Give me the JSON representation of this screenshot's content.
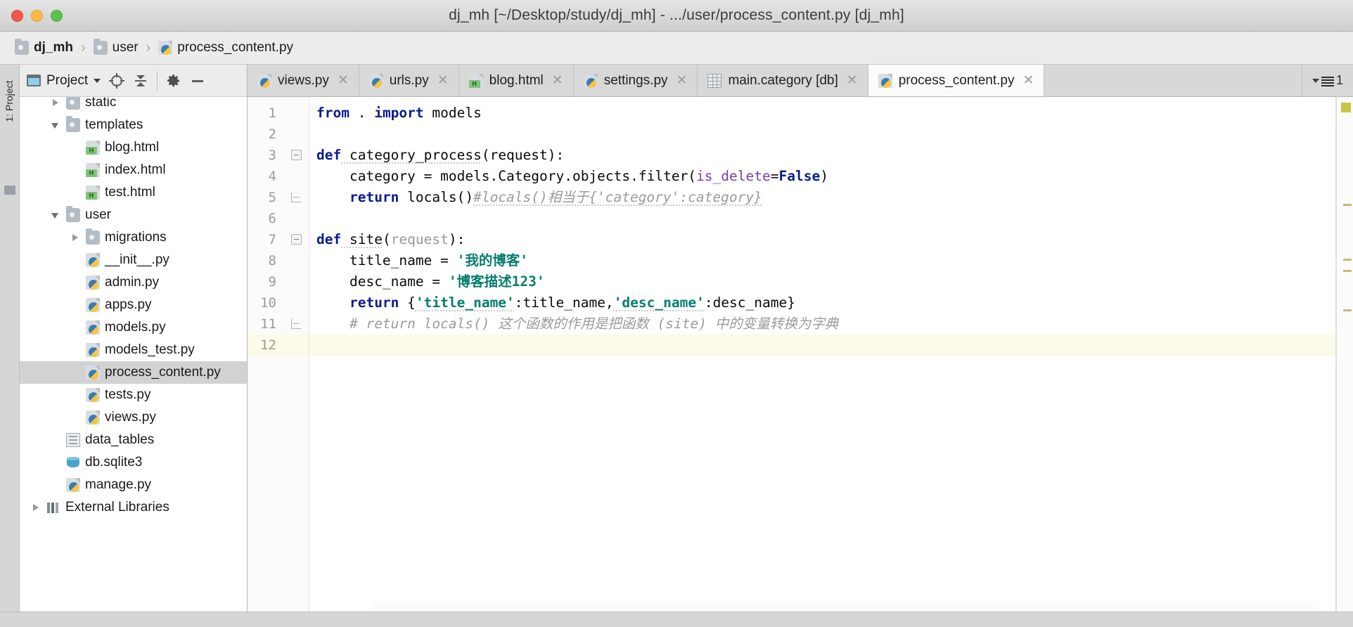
{
  "window": {
    "title": "dj_mh [~/Desktop/study/dj_mh] - .../user/process_content.py [dj_mh]",
    "traffic_lights": [
      "close",
      "minimize",
      "zoom"
    ]
  },
  "breadcrumb": {
    "items": [
      {
        "label": "dj_mh",
        "icon": "folder-icon",
        "bold": true
      },
      {
        "label": "user",
        "icon": "folder-icon",
        "bold": false
      },
      {
        "label": "process_content.py",
        "icon": "python-file-icon",
        "bold": false
      }
    ],
    "separator": "›"
  },
  "rail": {
    "project_tab_label": "1: Project"
  },
  "project_panel": {
    "title": "Project",
    "toolbar_buttons": [
      {
        "name": "select-opened-file",
        "glyph": "⊕"
      },
      {
        "name": "collapse-all",
        "glyph": "⤓"
      },
      {
        "name": "settings",
        "glyph": "⚙"
      },
      {
        "name": "hide",
        "glyph": "—"
      }
    ],
    "tree": [
      {
        "label": "static",
        "icon": "folder-icon",
        "arrow": "right",
        "indent": 2,
        "selected": false,
        "clipped": true
      },
      {
        "label": "templates",
        "icon": "folder-icon",
        "arrow": "down",
        "indent": 2,
        "selected": false
      },
      {
        "label": "blog.html",
        "icon": "html-file-icon",
        "arrow": "none",
        "indent": 3,
        "selected": false
      },
      {
        "label": "index.html",
        "icon": "html-file-icon",
        "arrow": "none",
        "indent": 3,
        "selected": false
      },
      {
        "label": "test.html",
        "icon": "html-file-icon",
        "arrow": "none",
        "indent": 3,
        "selected": false
      },
      {
        "label": "user",
        "icon": "folder-icon",
        "arrow": "down",
        "indent": 2,
        "selected": false
      },
      {
        "label": "migrations",
        "icon": "folder-icon",
        "arrow": "right",
        "indent": 3,
        "selected": false
      },
      {
        "label": "__init__.py",
        "icon": "python-file-icon",
        "arrow": "none",
        "indent": 3,
        "selected": false
      },
      {
        "label": "admin.py",
        "icon": "python-file-icon",
        "arrow": "none",
        "indent": 3,
        "selected": false
      },
      {
        "label": "apps.py",
        "icon": "python-file-icon",
        "arrow": "none",
        "indent": 3,
        "selected": false
      },
      {
        "label": "models.py",
        "icon": "python-file-icon",
        "arrow": "none",
        "indent": 3,
        "selected": false
      },
      {
        "label": "models_test.py",
        "icon": "python-file-icon",
        "arrow": "none",
        "indent": 3,
        "selected": false
      },
      {
        "label": "process_content.py",
        "icon": "python-file-icon",
        "arrow": "none",
        "indent": 3,
        "selected": true
      },
      {
        "label": "tests.py",
        "icon": "python-file-icon",
        "arrow": "none",
        "indent": 3,
        "selected": false
      },
      {
        "label": "views.py",
        "icon": "python-file-icon",
        "arrow": "none",
        "indent": 3,
        "selected": false
      },
      {
        "label": "data_tables",
        "icon": "data-table-icon",
        "arrow": "none",
        "indent": 2,
        "selected": false
      },
      {
        "label": "db.sqlite3",
        "icon": "database-icon",
        "arrow": "none",
        "indent": 2,
        "selected": false
      },
      {
        "label": "manage.py",
        "icon": "python-file-icon",
        "arrow": "none",
        "indent": 2,
        "selected": false
      },
      {
        "label": "External Libraries",
        "icon": "library-icon",
        "arrow": "right",
        "indent": 1,
        "selected": false
      }
    ]
  },
  "editor": {
    "tabs": [
      {
        "label": "views.py",
        "icon": "python-file-icon",
        "active": false,
        "closable": true
      },
      {
        "label": "urls.py",
        "icon": "python-file-icon",
        "active": false,
        "closable": true
      },
      {
        "label": "blog.html",
        "icon": "html-file-icon",
        "active": false,
        "closable": true
      },
      {
        "label": "settings.py",
        "icon": "python-file-icon",
        "active": false,
        "closable": true
      },
      {
        "label": "main.category [db]",
        "icon": "table-icon",
        "active": false,
        "closable": true
      },
      {
        "label": "process_content.py",
        "icon": "python-file-icon",
        "active": true,
        "closable": true
      }
    ],
    "close_glyph": "✕",
    "tab_overflow_count": "1",
    "filename": "process_content.py",
    "caret_line": 12,
    "line_numbers": [
      1,
      2,
      3,
      4,
      5,
      6,
      7,
      8,
      9,
      10,
      11,
      12
    ],
    "lines": [
      {
        "n": 1,
        "text": "from . import models"
      },
      {
        "n": 2,
        "text": ""
      },
      {
        "n": 3,
        "text": "def category_process(request):",
        "fold": "start"
      },
      {
        "n": 4,
        "text": "    category = models.Category.objects.filter(is_delete=False)"
      },
      {
        "n": 5,
        "text": "    return locals()#locals()相当于{'category':category}",
        "fold": "end"
      },
      {
        "n": 6,
        "text": ""
      },
      {
        "n": 7,
        "text": "def site(request):",
        "fold": "start"
      },
      {
        "n": 8,
        "text": "    title_name = '我的博客'"
      },
      {
        "n": 9,
        "text": "    desc_name = '博客描述123'"
      },
      {
        "n": 10,
        "text": "    return {'title_name':title_name,'desc_name':desc_name}"
      },
      {
        "n": 11,
        "text": "    # return locals() 这个函数的作用是把函数 (site) 中的变量转换为字典",
        "fold": "end"
      },
      {
        "n": 12,
        "text": ""
      }
    ],
    "tokens": {
      "line1": {
        "kw1": "from",
        "dot": " . ",
        "kw2": "import",
        "rest": " models"
      },
      "line3": {
        "kw": "def",
        "name": " category_process",
        "paren_open": "(",
        "param": "request",
        "paren_close": ")",
        "colon": ":"
      },
      "line4": {
        "indent": "    ",
        "var": "category = models.Category.objects.filter(",
        "kwarg": "is_delete",
        "eq": "=",
        "const": "False",
        "close": ")"
      },
      "line5": {
        "indent": "    ",
        "kw": "return",
        "call": " locals()",
        "comment": "#locals()相当于{'category':category}"
      },
      "line7": {
        "kw": "def",
        "name": " site",
        "paren_open": "(",
        "param": "request",
        "paren_close": ")",
        "colon": ":"
      },
      "line8": {
        "indent": "    ",
        "var": "title_name = ",
        "str": "'我的博客'"
      },
      "line9": {
        "indent": "    ",
        "var": "desc_name = ",
        "str": "'博客描述123'"
      },
      "line10": {
        "indent": "    ",
        "kw": "return",
        "open": " {",
        "k1": "'title_name'",
        "v1": ":title_name,",
        "k2": "'desc_name'",
        "v2": ":desc_name",
        "close": "}"
      },
      "line11": {
        "indent": "    ",
        "comment": "# return locals() 这个函数的作用是把函数 (site) 中的变量转换为字典"
      }
    }
  },
  "colors": {
    "keyword": "#0a1c8c",
    "string": "#068b79",
    "comment": "#9b9b9b",
    "kwarg": "#7a3fa8",
    "selection": "#d2d2d2",
    "caret_line": "#fcfae8",
    "titlebar": "#dcdcdc",
    "tabbar": "#d8d8d8"
  }
}
